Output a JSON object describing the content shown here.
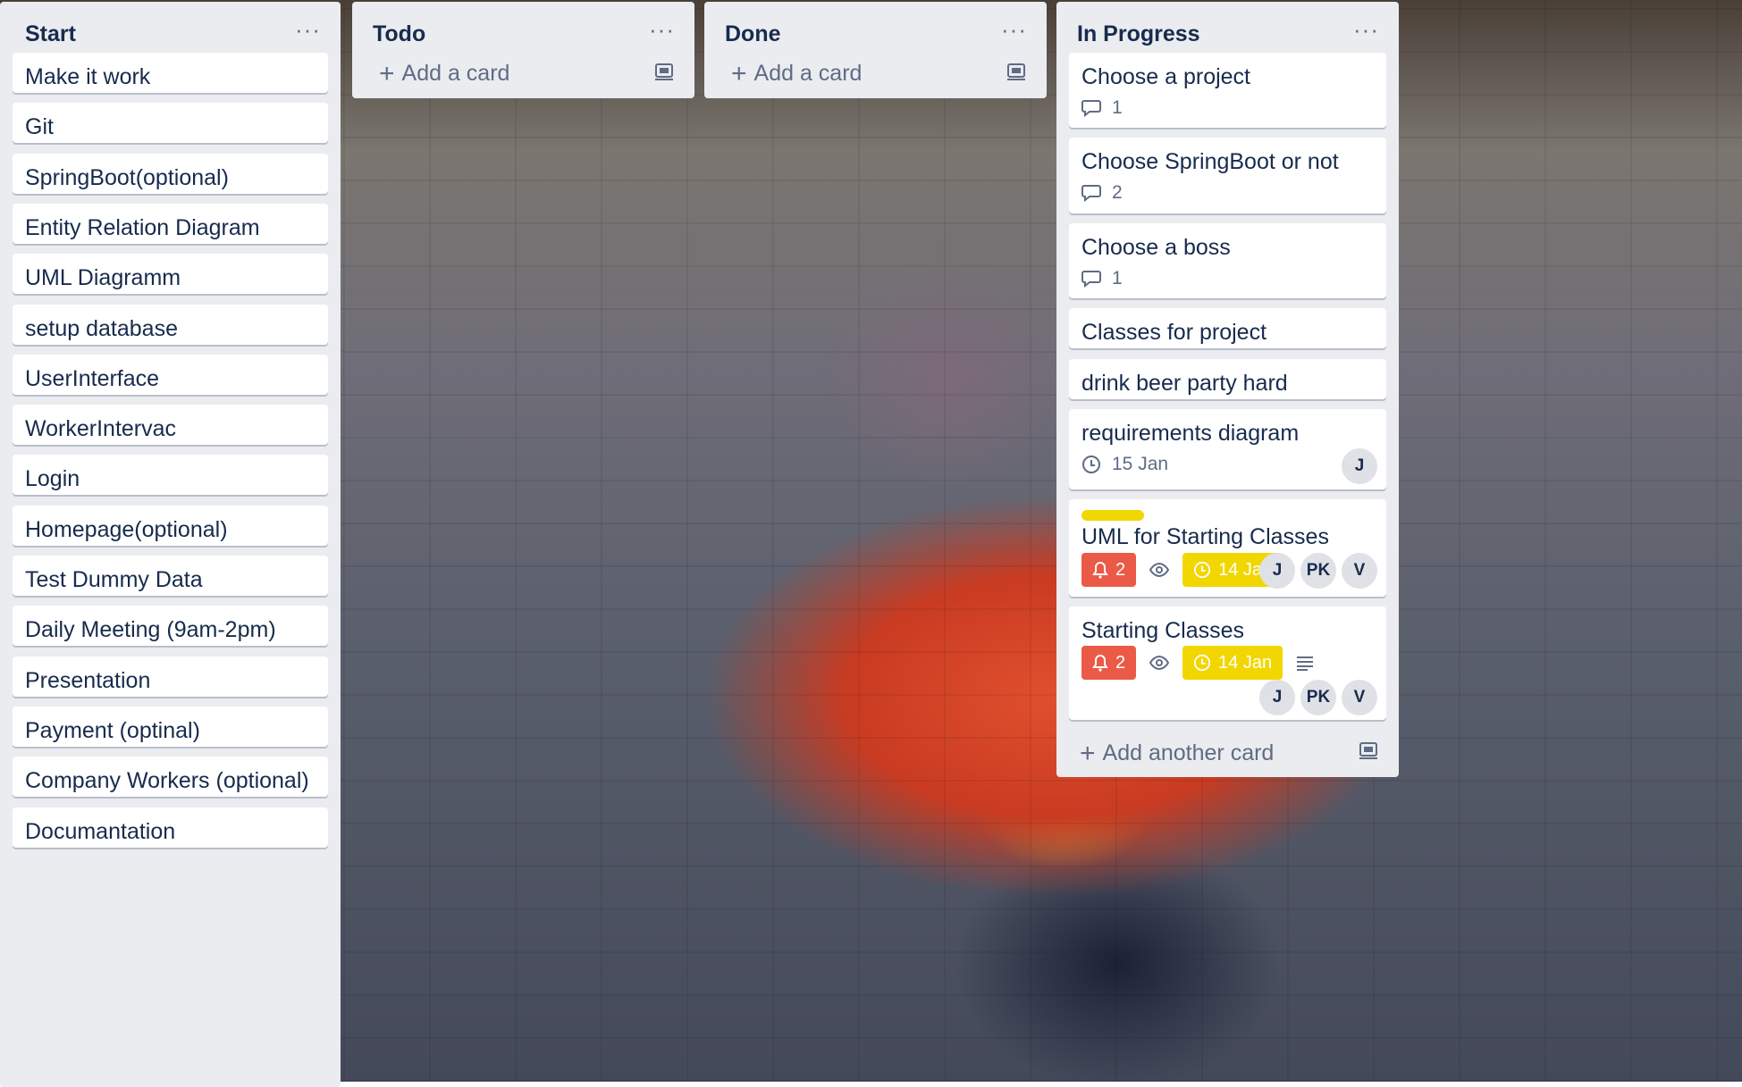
{
  "colors": {
    "list_bg": "#ebecf0",
    "card_bg": "#ffffff",
    "text": "#172b4d",
    "muted": "#5e6c84",
    "label_yellow": "#f2d600",
    "due_yellow": "#f2d600",
    "alert_red": "#eb5a46"
  },
  "lists": {
    "start": {
      "title": "Start",
      "menu": "···",
      "cards": [
        "Make it work",
        "Git",
        "SpringBoot(optional)",
        "Entity Relation Diagram",
        "UML Diagramm",
        "setup database",
        "UserInterface",
        "WorkerIntervac",
        "Login",
        "Homepage(optional)",
        "Test Dummy Data",
        "Daily Meeting (9am-2pm)",
        "Presentation",
        "Payment (optinal)",
        "Company Workers (optional)",
        "Documantation"
      ]
    },
    "todo": {
      "title": "Todo",
      "menu": "···",
      "add_label": "Add a card"
    },
    "done": {
      "title": "Done",
      "menu": "···",
      "add_label": "Add a card"
    },
    "in_progress": {
      "title": "In Progress",
      "menu": "···",
      "add_label": "Add another card",
      "cards": {
        "c1": {
          "title": "Choose a project",
          "comments": "1"
        },
        "c2": {
          "title": "Choose SpringBoot or not",
          "comments": "2"
        },
        "c3": {
          "title": "Choose a boss",
          "comments": "1"
        },
        "c4": {
          "title": "Classes for project"
        },
        "c5": {
          "title": "drink beer party hard"
        },
        "c6": {
          "title": "requirements diagram",
          "due": "15 Jan",
          "members": [
            "J"
          ]
        },
        "c7": {
          "title": "UML for Starting Classes",
          "label": "yellow",
          "notifications": "2",
          "due": "14 Jan",
          "members": [
            "J",
            "PK",
            "V"
          ]
        },
        "c8": {
          "title": "Starting Classes",
          "notifications": "2",
          "due": "14 Jan",
          "members": [
            "J",
            "PK",
            "V"
          ]
        }
      }
    }
  },
  "icons": [
    "comment-icon",
    "clock-icon",
    "bell-icon",
    "eye-icon",
    "description-icon",
    "card-template-icon",
    "plus-icon"
  ]
}
